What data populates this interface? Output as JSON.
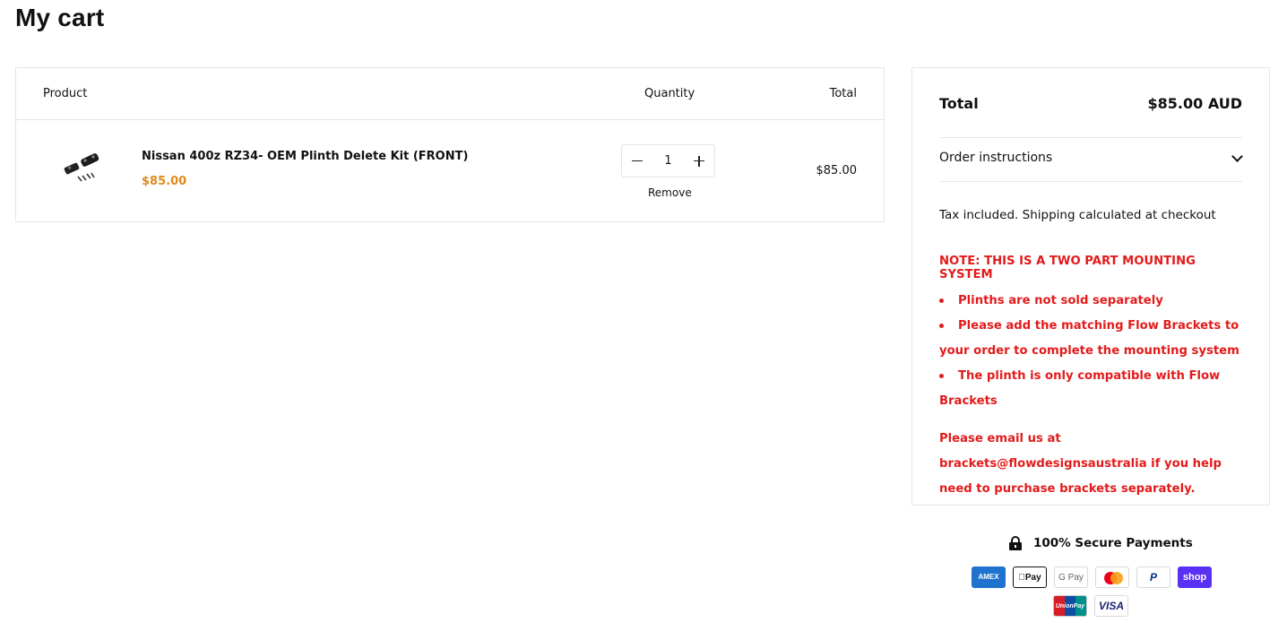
{
  "page": {
    "title": "My cart"
  },
  "cart": {
    "headers": {
      "product": "Product",
      "quantity": "Quantity",
      "total": "Total"
    },
    "items": [
      {
        "title": "Nissan 400z RZ34- OEM Plinth Delete Kit (FRONT)",
        "price": "$85.00",
        "quantity": "1",
        "remove_label": "Remove",
        "line_total": "$85.00",
        "thumbnail_icon": "plinth-kit-image"
      }
    ]
  },
  "summary": {
    "total_label": "Total",
    "total_value": "$85.00 AUD",
    "order_instructions_label": "Order instructions",
    "tax_note": "Tax included. Shipping calculated at checkout",
    "note_heading": "NOTE: THIS IS A TWO PART MOUNTING SYSTEM",
    "note_items": [
      "Plinths are not sold separately",
      "Please add the matching Flow Brackets to your order to complete the mounting system",
      "The plinth is only compatible with Flow Brackets"
    ],
    "email_note": "Please email us at brackets@flowdesignsaustralia if you help need to purchase brackets separately."
  },
  "secure": {
    "label": "100% Secure Payments",
    "payment_methods": [
      {
        "name": "amex",
        "label": "AMEX"
      },
      {
        "name": "apple-pay",
        "label": "Pay"
      },
      {
        "name": "google-pay",
        "label": "G Pay"
      },
      {
        "name": "mastercard",
        "label": ""
      },
      {
        "name": "paypal",
        "label": "P"
      },
      {
        "name": "shop-pay",
        "label": "shop"
      },
      {
        "name": "unionpay",
        "label": "UnionPay"
      },
      {
        "name": "visa",
        "label": "VISA"
      }
    ]
  },
  "colors": {
    "accent_price": "#e08a1e",
    "note_red": "#e31b1b",
    "border": "#e6e6e6"
  }
}
